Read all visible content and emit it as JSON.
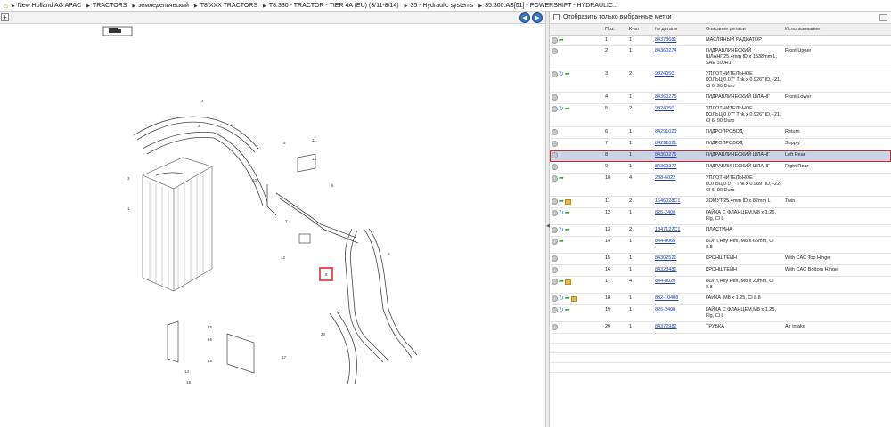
{
  "breadcrumb": {
    "home_icon": "home-icon",
    "items": [
      "New Holland AG APAC",
      "TRACTORS",
      "земледельческий",
      "T8.XXX TRACTORS",
      "T8.330 - TRACTOR - TIER 4A (EU) (3/11-8/14)",
      "35 - Hydraulic systems",
      "35.300.AB[01] - POWERSHIFT - HYDRAULIC..."
    ]
  },
  "toolbar": {
    "expand_label": "+",
    "prev_label": "◀",
    "next_label": "▶"
  },
  "filter": {
    "label": "Отобразить только выбранные метки"
  },
  "table": {
    "headers": [
      "Поз.",
      "К-во",
      "№ детали",
      "Описание детали",
      "Использование"
    ],
    "rows": [
      {
        "pos": "1",
        "qty": "1",
        "part": "84378681",
        "desc": "МАСЛЯНЫЙ РАДИАТОР",
        "usage": "",
        "icons": [
          "fwd"
        ]
      },
      {
        "pos": "2",
        "qty": "1",
        "part": "84360274",
        "desc": "ГИДРАВЛИЧЕСКИЙ ШЛАНГ,25.4mm ID x 1538mm L, SAE 100R1",
        "usage": "Front Upper",
        "icons": []
      },
      {
        "pos": "3",
        "qty": "2",
        "part": "9824050",
        "desc": "УПЛОТНИТЕЛЬНОЕ КОЛЬЦ,0.07\" Thk x 0.926\" ID, -21, Cl 6, 90 Duro",
        "usage": "",
        "icons": [
          "note",
          "fwd"
        ]
      },
      {
        "pos": "4",
        "qty": "1",
        "part": "84360275",
        "desc": "ГИДРАВЛИЧЕСКИЙ ШЛАНГ",
        "usage": "Front Lower",
        "icons": []
      },
      {
        "pos": "5",
        "qty": "2",
        "part": "9824050",
        "desc": "УПЛОТНИТЕЛЬНОЕ КОЛЬЦ,0.07\" Thk x 0.926\" ID, -21, Cl 6, 90 Duro",
        "usage": "",
        "icons": [
          "note",
          "fwd"
        ]
      },
      {
        "pos": "6",
        "qty": "1",
        "part": "84291020",
        "desc": "ГИДРОПРОВОД",
        "usage": "Return",
        "icons": []
      },
      {
        "pos": "7",
        "qty": "1",
        "part": "84291021",
        "desc": "ГИДРОПРОВОД",
        "usage": "Supply",
        "icons": []
      },
      {
        "pos": "8",
        "qty": "1",
        "part": "84360276",
        "desc": "ГИДРАВЛИЧЕСКИЙ ШЛАНГ",
        "usage": "Left Rear",
        "icons": [],
        "selected": true
      },
      {
        "pos": "9",
        "qty": "1",
        "part": "84360277",
        "desc": "ГИДРАВЛИЧЕСКИЙ ШЛАНГ",
        "usage": "Right Rear",
        "icons": []
      },
      {
        "pos": "10",
        "qty": "4",
        "part": "238-6022",
        "desc": "УПЛОТНИТЕЛЬНОЕ КОЛЬЦ,0.07\" Thk x 0.989\" ID, -22, Cl 6, 90 Duro",
        "usage": "",
        "icons": [
          "fwd"
        ]
      },
      {
        "pos": "11",
        "qty": "2",
        "part": "1546028C1",
        "desc": "ХОМУТ,25.4mm ID x 82mm L",
        "usage": "Twin",
        "icons": [
          "fwd",
          "box"
        ]
      },
      {
        "pos": "12",
        "qty": "1",
        "part": "825-2408",
        "desc": "ГАЙКА С ФЛАНЦЕМ,M8 x 1.25, Flg, Cl 8",
        "usage": "",
        "icons": [
          "note",
          "fwd"
        ]
      },
      {
        "pos": "13",
        "qty": "2",
        "part": "1347127C1",
        "desc": "ПЛАСТИНА",
        "usage": "",
        "icons": [
          "note",
          "fwd"
        ]
      },
      {
        "pos": "14",
        "qty": "1",
        "part": "844-8065",
        "desc": "БОЛТ,Hxy Hex, M8 x 65mm, Cl 8.8",
        "usage": "",
        "icons": [
          "fwd"
        ]
      },
      {
        "pos": "15",
        "qty": "1",
        "part": "84302521",
        "desc": "КРОНШТЕЙН",
        "usage": "With CAC Top Hinge",
        "icons": []
      },
      {
        "pos": "16",
        "qty": "1",
        "part": "84323481",
        "desc": "КРОНШТЕЙН",
        "usage": "With CAC Bottom Hinge",
        "icons": []
      },
      {
        "pos": "17",
        "qty": "4",
        "part": "844-8020",
        "desc": "БОЛТ,Hxy Hex, M8 x 20mm, Cl 8.8",
        "usage": "",
        "icons": [
          "fwd",
          "box"
        ]
      },
      {
        "pos": "18",
        "qty": "1",
        "part": "832-10408",
        "desc": "ГАЙКА ,M8 x 1.25, Cl 8.8",
        "usage": "",
        "icons": [
          "note",
          "fwd",
          "box"
        ]
      },
      {
        "pos": "19",
        "qty": "1",
        "part": "825-2408",
        "desc": "ГАЙКА С ФЛАНЦЕМ,M8 x 1.25, Flg, Cl 8",
        "usage": "",
        "icons": [
          "note",
          "fwd"
        ]
      },
      {
        "pos": "20",
        "qty": "1",
        "part": "84372982",
        "desc": "ТРУБКА",
        "usage": "Air intake",
        "icons": []
      }
    ]
  },
  "diagram": {
    "callouts": [
      "1",
      "2",
      "3",
      "4",
      "5",
      "6",
      "7",
      "8",
      "9",
      "10",
      "11",
      "12",
      "13",
      "14",
      "15",
      "16",
      "17",
      "18",
      "19",
      "20"
    ]
  },
  "colors": {
    "selection": "#c9d5e6",
    "highlight_border": "#e02020",
    "link": "#1f3fbf"
  }
}
